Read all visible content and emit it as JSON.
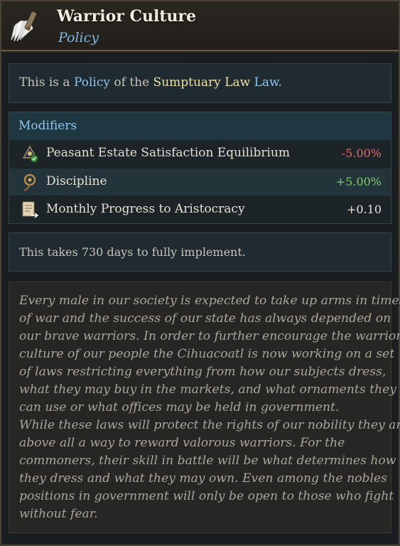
{
  "header": {
    "title": "Warrior Culture",
    "subtitle": "Policy",
    "icon": "feather-fan-icon"
  },
  "description": {
    "prefix": "This is a ",
    "policy_link": "Policy",
    "middle": " of the ",
    "law_name": "Sumptuary Law",
    "law_link": " Law",
    "suffix": "."
  },
  "modifiers": {
    "heading": "Modifiers",
    "items": [
      {
        "icon": "estate-satisfaction-icon",
        "label": "Peasant Estate Satisfaction Equilibrium",
        "value": "-5.00%",
        "tone": "negative"
      },
      {
        "icon": "discipline-icon",
        "label": "Discipline",
        "value": "+5.00%",
        "tone": "positive"
      },
      {
        "icon": "aristocracy-progress-icon",
        "label": "Monthly Progress to Aristocracy",
        "value": "+0.10",
        "tone": "neutral"
      }
    ]
  },
  "implementation": {
    "text": "This takes 730 days to fully implement."
  },
  "flavor_text": {
    "lines": [
      "Every male in our society is expected to take up arms in times",
      "of war and the success of our state has always depended on",
      "our brave warriors. In order to further encourage the warrior",
      "culture of our people the Cihuacoatl is now working on a set",
      "of laws restricting everything from how our subjects dress,",
      "what they may buy in the markets, and what ornaments they",
      "can use or what offices may be held in government.",
      "While these laws will protect the rights of our nobility they are",
      "above all a way to reward valorous warriors. For the",
      "commoners, their skill in battle will be what determines how",
      "they dress and what they may own. Even among the nobles",
      "positions in government will only be open to those who fight",
      "without fear."
    ]
  },
  "colors": {
    "accent_blue": "#8ec4ee",
    "gold": "#efe0a6",
    "negative": "#e06a6a",
    "positive": "#79cf6c"
  }
}
